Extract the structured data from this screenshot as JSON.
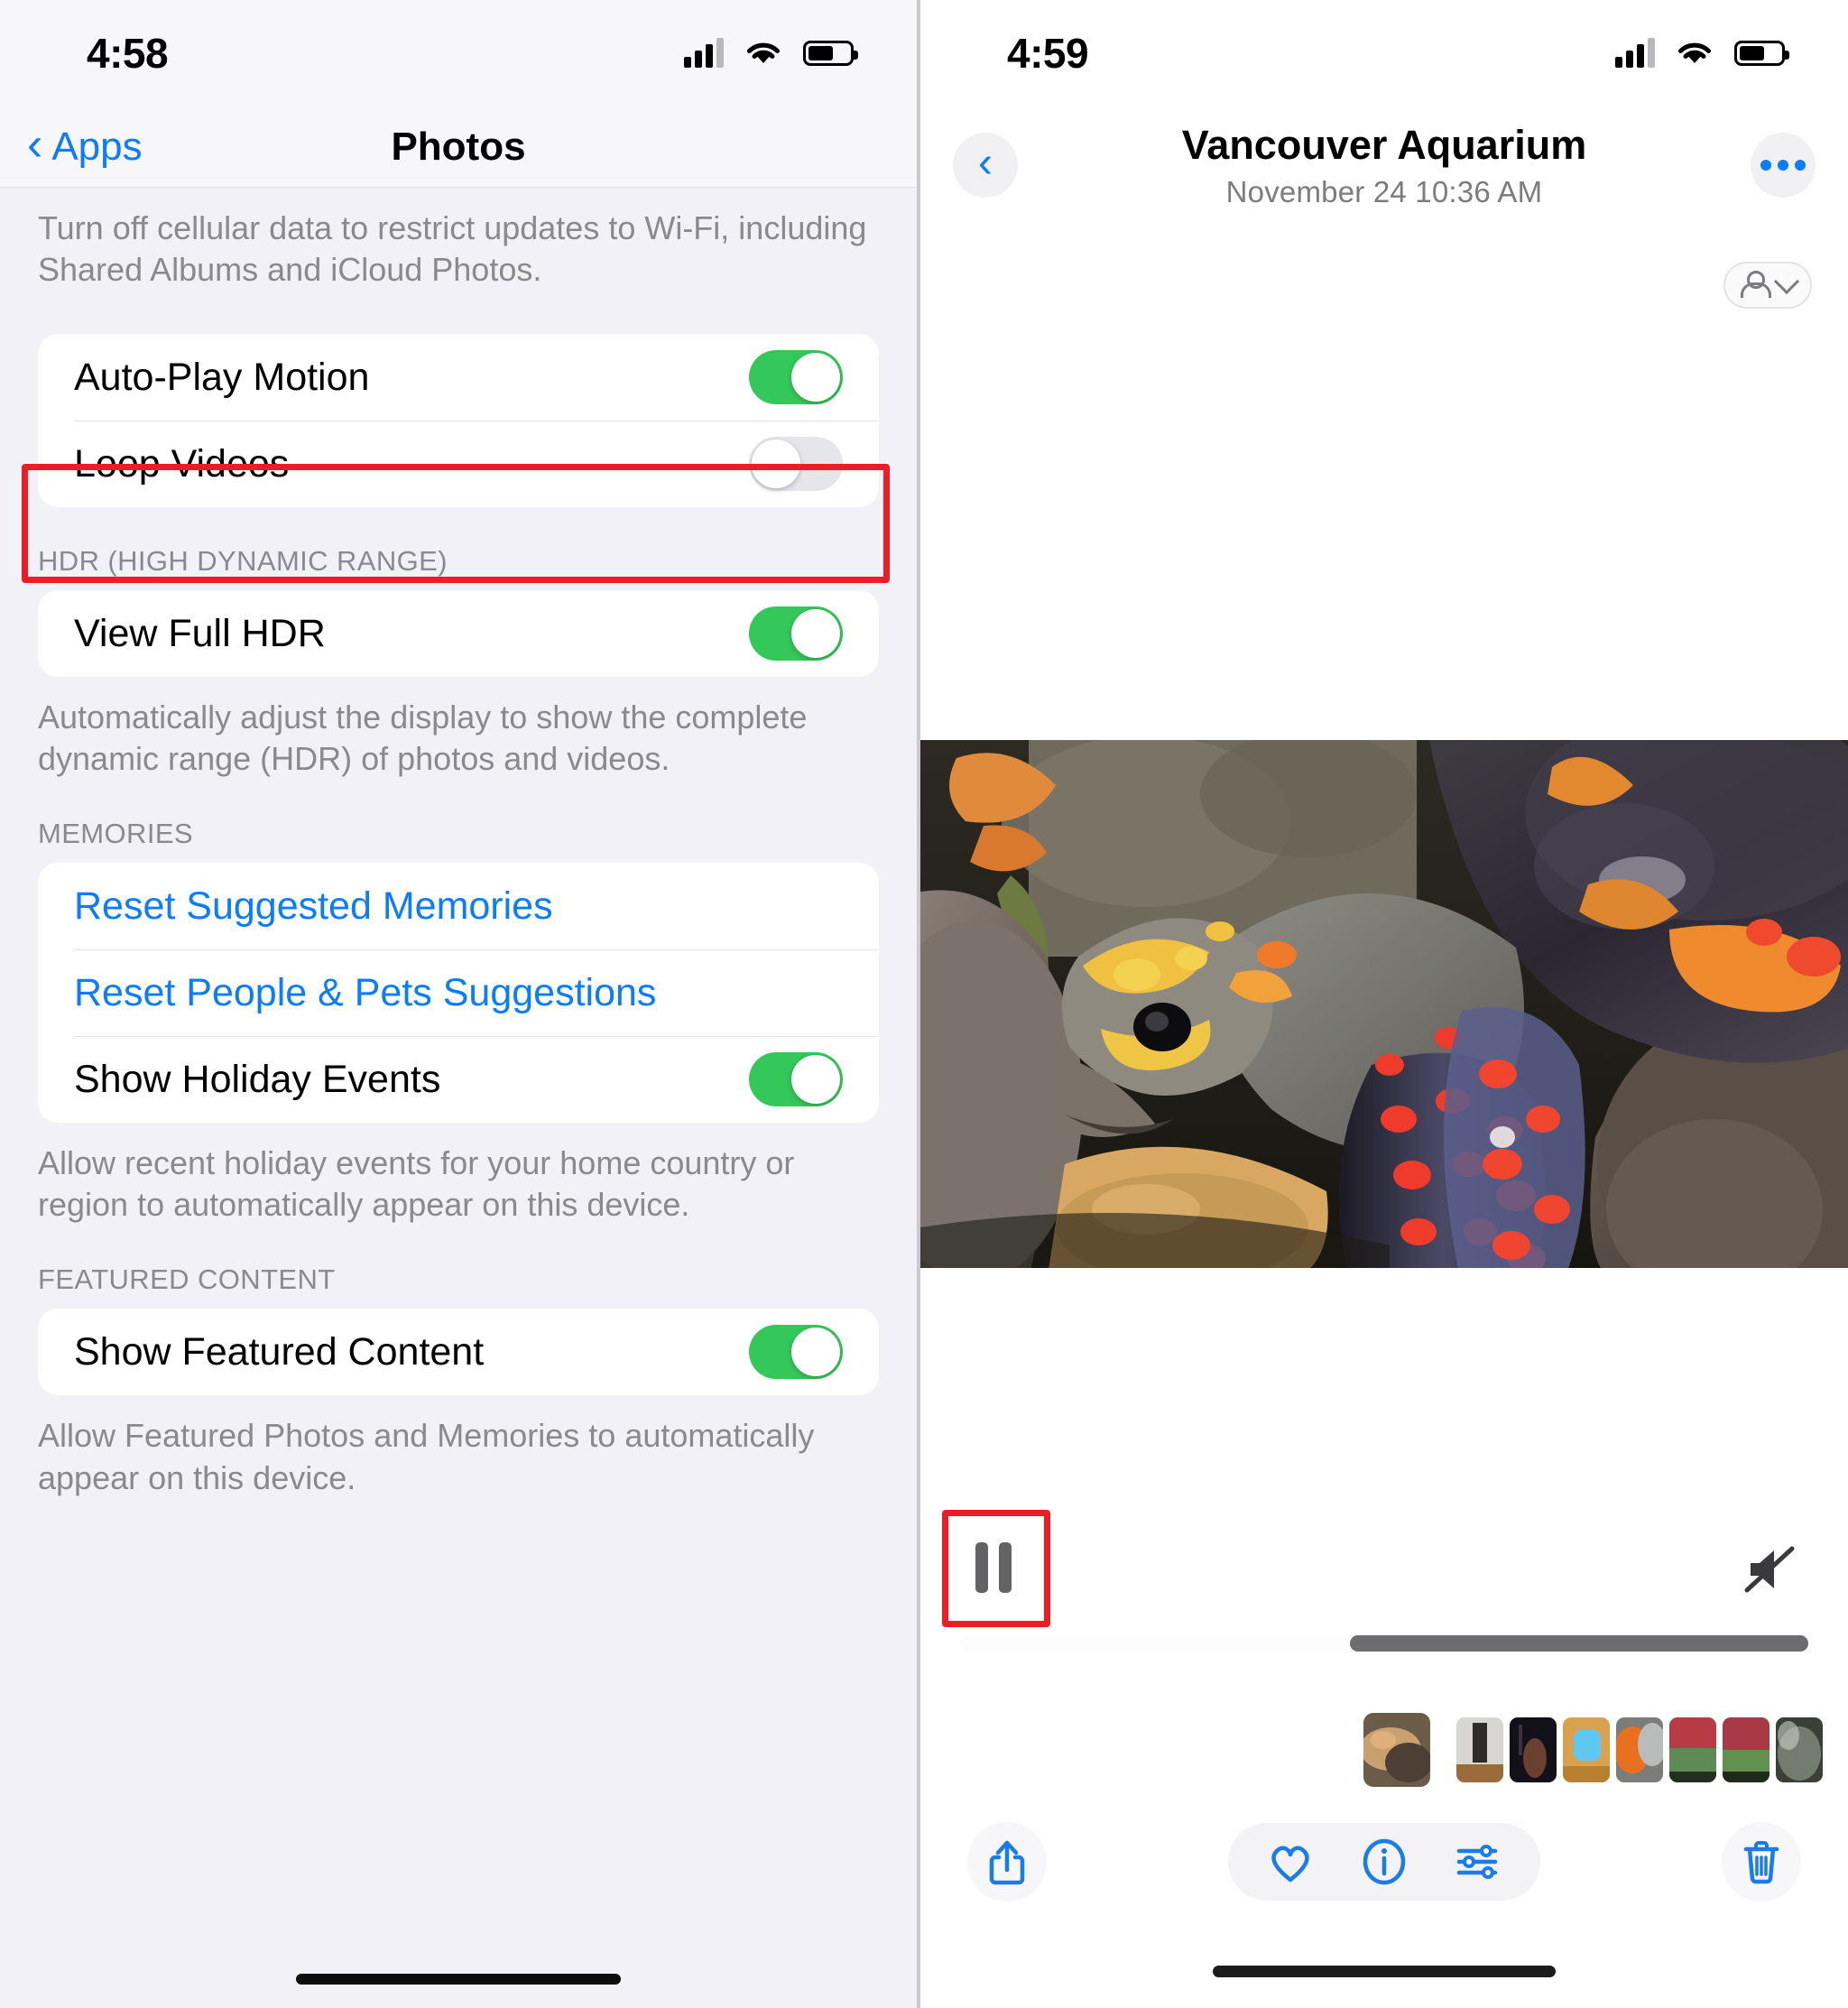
{
  "left_phone": {
    "status": {
      "time": "4:58",
      "signal_icon": "cellular-bars-icon",
      "wifi_icon": "wifi-icon",
      "battery_icon": "battery-icon"
    },
    "nav": {
      "back_label": "Apps",
      "title": "Photos",
      "back_icon": "chevron-left-icon"
    },
    "cellular_footnote": "Turn off cellular data to restrict updates to Wi-Fi, including Shared Albums and iCloud Photos.",
    "playback_group": {
      "rows": [
        {
          "label": "Auto-Play Motion",
          "toggle": "on"
        },
        {
          "label": "Loop Videos",
          "toggle": "off",
          "highlighted": true
        }
      ]
    },
    "hdr_group": {
      "header": "HDR (HIGH DYNAMIC RANGE)",
      "rows": [
        {
          "label": "View Full HDR",
          "toggle": "on"
        }
      ],
      "footnote": "Automatically adjust the display to show the complete dynamic range (HDR) of photos and videos."
    },
    "memories_group": {
      "header": "MEMORIES",
      "rows": [
        {
          "label": "Reset Suggested Memories",
          "type": "link"
        },
        {
          "label": "Reset People & Pets Suggestions",
          "type": "link"
        },
        {
          "label": "Show Holiday Events",
          "toggle": "on"
        }
      ],
      "footnote": "Allow recent holiday events for your home country or region to automatically appear on this device."
    },
    "featured_group": {
      "header": "FEATURED CONTENT",
      "rows": [
        {
          "label": "Show Featured Content",
          "toggle": "on"
        }
      ],
      "footnote": "Allow Featured Photos and Memories to automatically appear on this device."
    },
    "highlight_color": "#ee1c25",
    "accent_color": "#0a7cff",
    "toggle_on_color": "#34c759"
  },
  "right_phone": {
    "status": {
      "time": "4:59",
      "signal_icon": "cellular-bars-icon",
      "wifi_icon": "wifi-icon",
      "battery_icon": "battery-icon"
    },
    "nav": {
      "back_icon": "chevron-left-icon",
      "title": "Vancouver Aquarium",
      "subtitle": "November 24  10:36 AM",
      "more_icon": "ellipsis-icon"
    },
    "people_chip": {
      "person_icon": "person-icon",
      "chevron_icon": "chevron-down-icon"
    },
    "media": {
      "alt": "red-footed tortoise close-up",
      "progress_percent": 54
    },
    "playback": {
      "pause_icon": "pause-icon",
      "mute_icon": "speaker-mute-icon",
      "pause_highlighted": true
    },
    "toolbar": {
      "share_icon": "share-icon",
      "favorite_icon": "heart-icon",
      "info_icon": "info-icon",
      "adjust_icon": "adjustments-icon",
      "delete_icon": "trash-icon"
    },
    "filmstrip_count": 8,
    "accent_color": "#0a7cff",
    "highlight_color": "#ee1c25"
  }
}
